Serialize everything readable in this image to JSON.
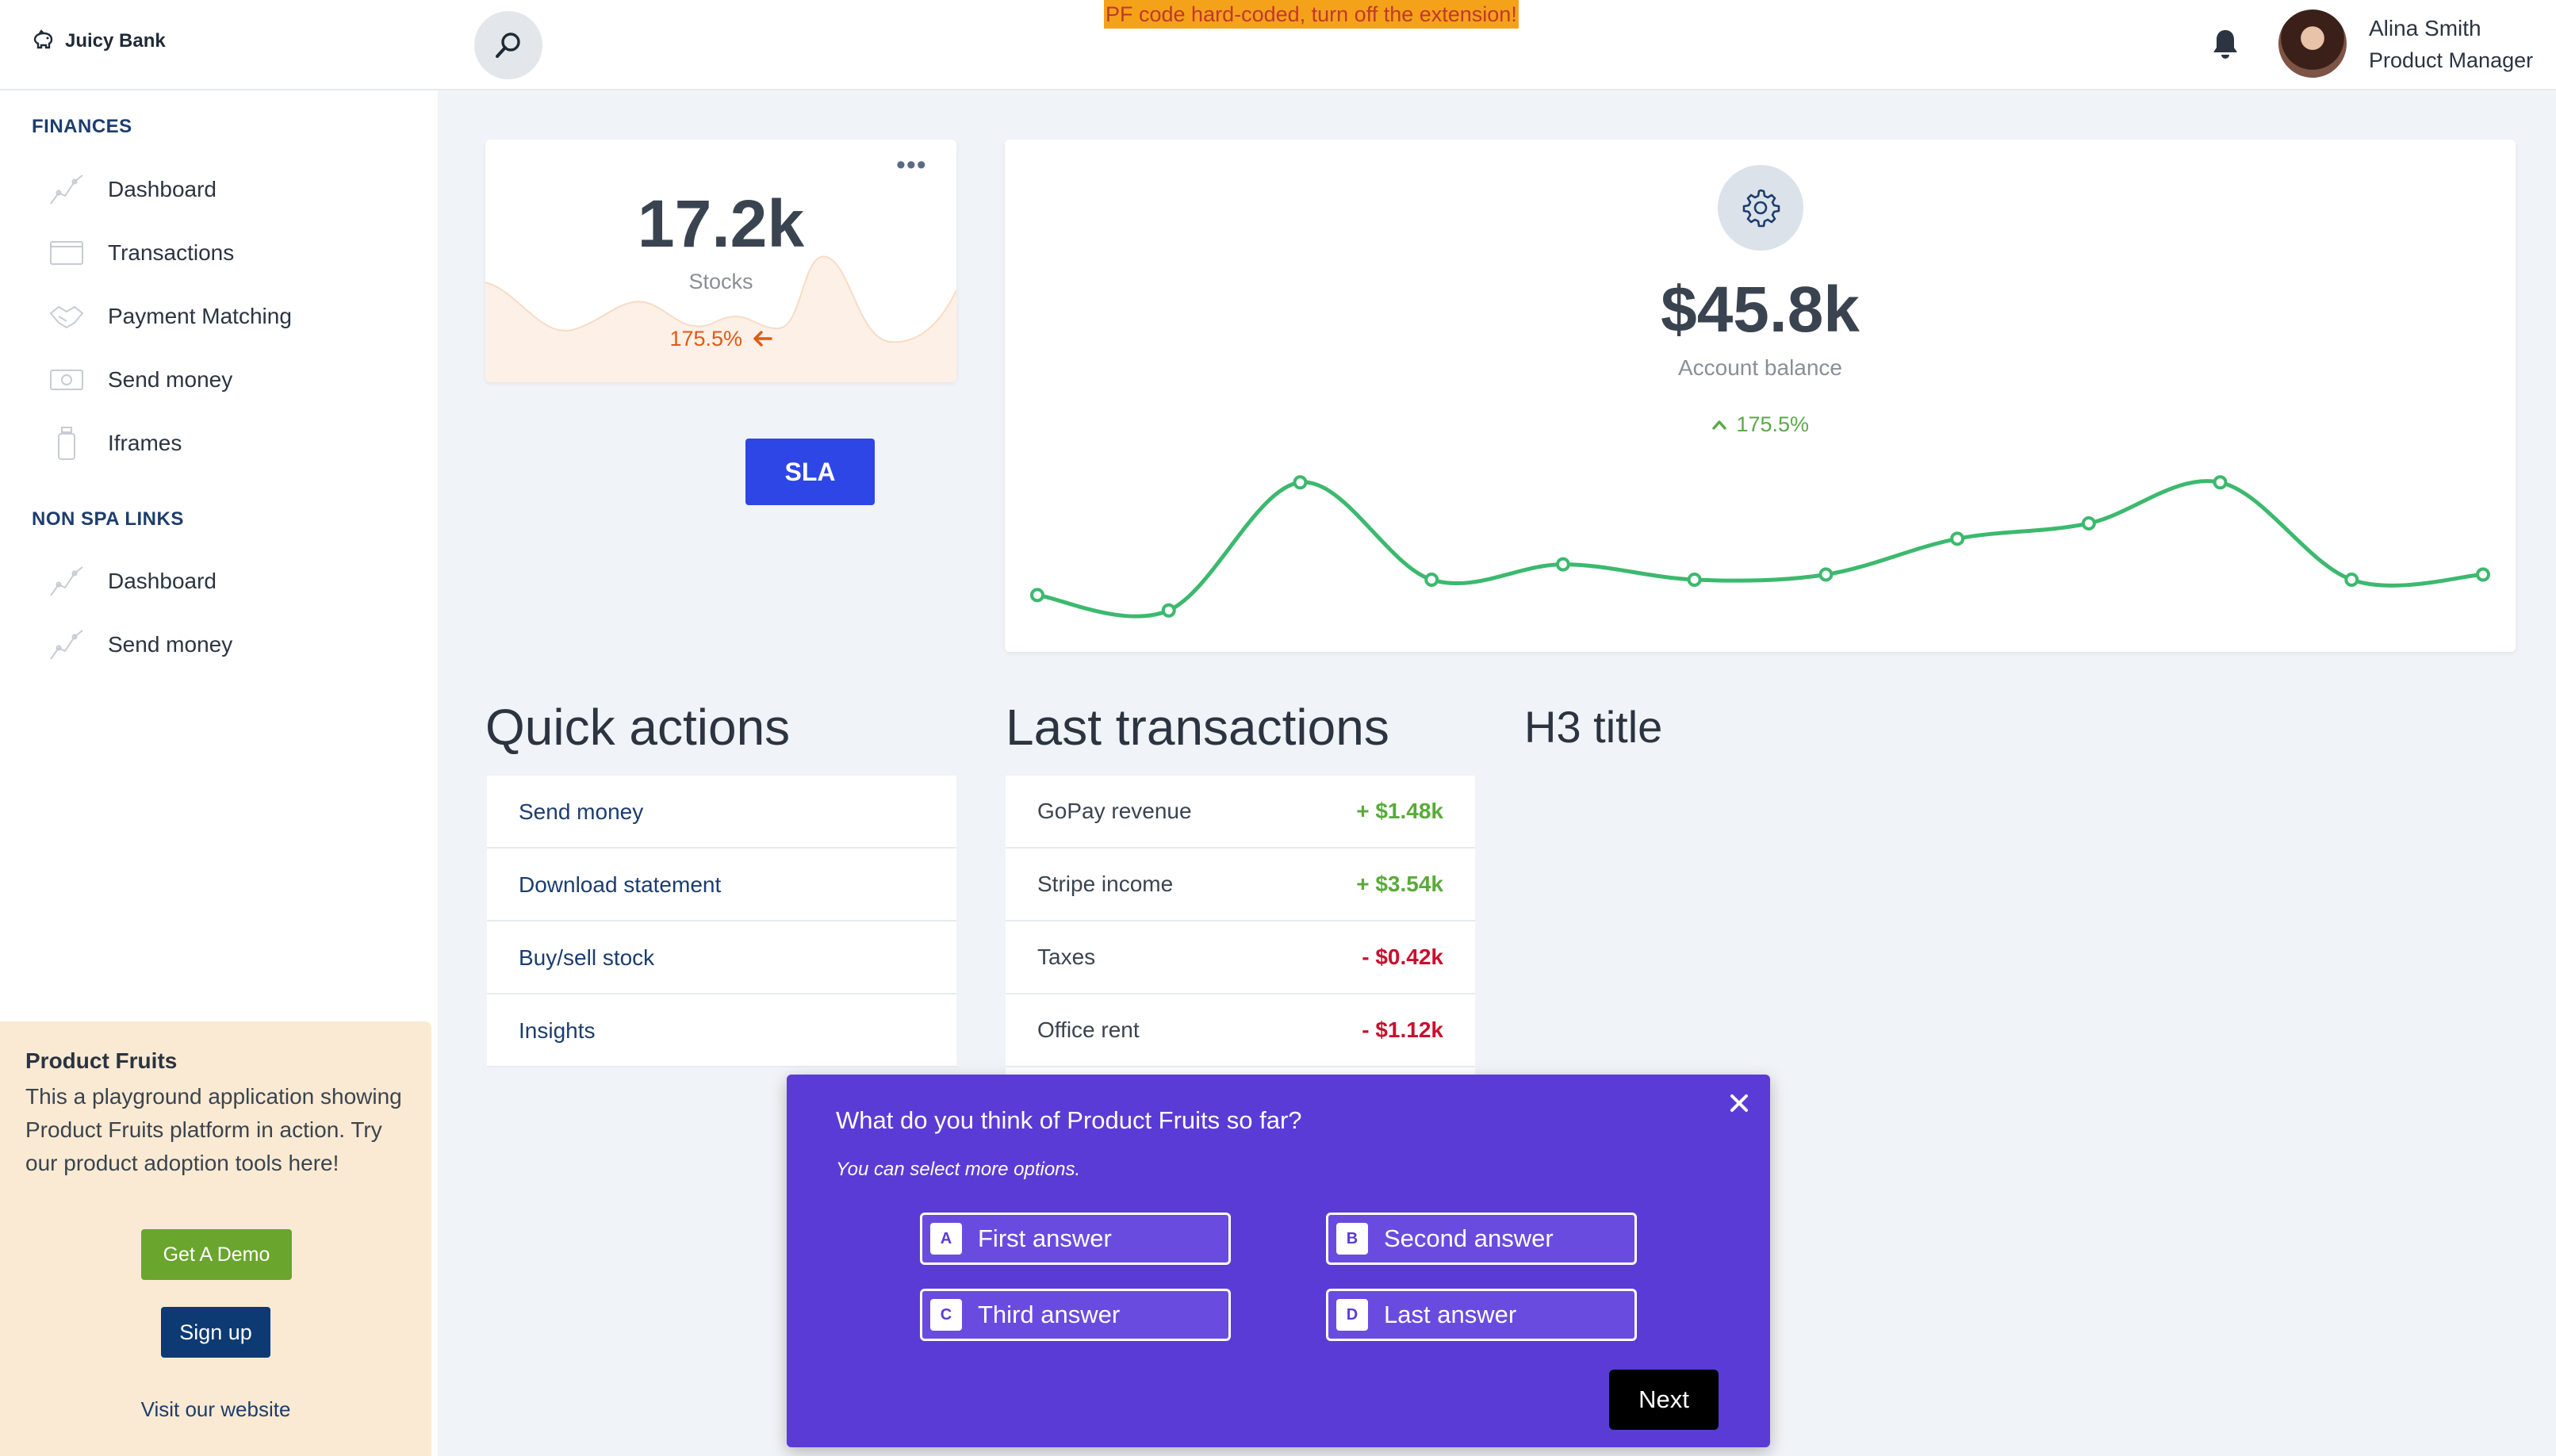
{
  "app": {
    "name": "Juicy Bank",
    "logo_icon": "piggy-bank-icon"
  },
  "header": {
    "warning": "PF code hard-coded, turn off the extension!",
    "search_icon": "search-icon",
    "bell_icon": "bell-icon",
    "user": {
      "name": "Alina Smith",
      "role": "Product Manager"
    }
  },
  "sidebar": {
    "sections": [
      {
        "title": "FINANCES",
        "items": [
          {
            "label": "Dashboard",
            "icon": "chart-line-icon"
          },
          {
            "label": "Transactions",
            "icon": "card-icon"
          },
          {
            "label": "Payment Matching",
            "icon": "handshake-icon"
          },
          {
            "label": "Send money",
            "icon": "money-icon"
          },
          {
            "label": "Iframes",
            "icon": "bottle-icon"
          }
        ]
      },
      {
        "title": "NON SPA LINKS",
        "items": [
          {
            "label": "Dashboard",
            "icon": "chart-line-icon"
          },
          {
            "label": "Send money",
            "icon": "chart-line-icon"
          }
        ]
      }
    ],
    "product_fruits": {
      "title": "Product Fruits",
      "description": "This a playground application showing Product Fruits platform in action. Try our product adoption tools here!",
      "demo_label": "Get A Demo",
      "signup_label": "Sign up",
      "visit_label": "Visit our website"
    }
  },
  "stocks_card": {
    "value": "17.2k",
    "label": "Stocks",
    "change": "175.5%",
    "change_icon": "arrow-left-icon",
    "menu_icon": "more-dots-icon"
  },
  "sla_button": "SLA",
  "balance_card": {
    "icon": "gear-icon",
    "value": "$45.8k",
    "label": "Account balance",
    "change": "175.5%",
    "change_icon": "chevron-up-icon",
    "line_color": "#3cb96e"
  },
  "chart_data": {
    "type": "line",
    "title": "",
    "xlabel": "",
    "ylabel": "",
    "series": [
      {
        "values": [
          8,
          5,
          30,
          11,
          14,
          11,
          12,
          19,
          22,
          30,
          11,
          12
        ]
      }
    ],
    "ylim": [
      0,
      35
    ],
    "grid": false
  },
  "quick_actions": {
    "title": "Quick actions",
    "items": [
      "Send money",
      "Download statement",
      "Buy/sell stock",
      "Insights"
    ]
  },
  "last_transactions": {
    "title": "Last transactions",
    "items": [
      {
        "name": "GoPay revenue",
        "amount": "+ $1.48k",
        "color": "#5aaa3a"
      },
      {
        "name": "Stripe income",
        "amount": "+ $3.54k",
        "color": "#5aaa3a"
      },
      {
        "name": "Taxes",
        "amount": "- $0.42k",
        "color": "#c8102e"
      },
      {
        "name": "Office rent",
        "amount": "- $1.12k",
        "color": "#c8102e"
      }
    ]
  },
  "h3_title": "H3 title",
  "survey": {
    "question": "What do you think of Product Fruits so far?",
    "hint": "You can select more options.",
    "answers": [
      {
        "key": "A",
        "text": "First answer"
      },
      {
        "key": "B",
        "text": "Second answer"
      },
      {
        "key": "C",
        "text": "Third answer"
      },
      {
        "key": "D",
        "text": "Last answer"
      }
    ],
    "next_label": "Next",
    "close_icon": "close-icon",
    "background": "#5b3bd6"
  }
}
